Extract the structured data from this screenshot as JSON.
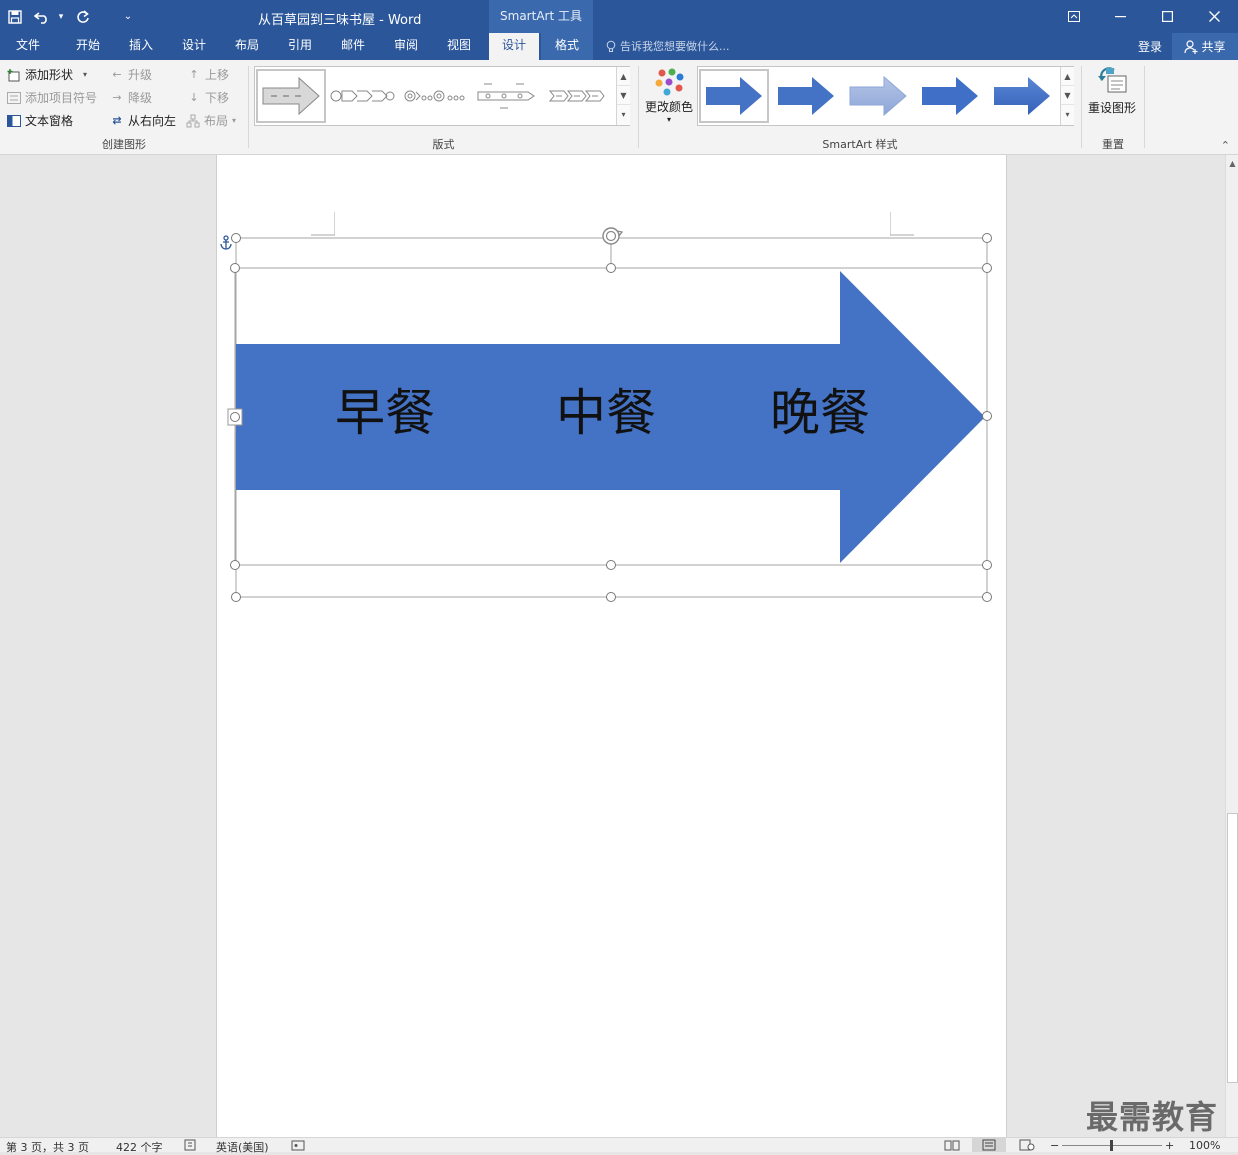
{
  "titlebar": {
    "doc_title": "从百草园到三味书屋 - Word",
    "context_title": "SmartArt 工具",
    "qat_customize": "⌄"
  },
  "tabs": [
    {
      "label": "文件"
    },
    {
      "label": "开始"
    },
    {
      "label": "插入"
    },
    {
      "label": "设计"
    },
    {
      "label": "布局"
    },
    {
      "label": "引用"
    },
    {
      "label": "邮件"
    },
    {
      "label": "审阅"
    },
    {
      "label": "视图"
    },
    {
      "label": "设计"
    },
    {
      "label": "格式"
    }
  ],
  "tellme": {
    "placeholder": "告诉我您想要做什么..."
  },
  "account": {
    "login": "登录",
    "share": "共享"
  },
  "ribbon": {
    "create": {
      "add_shape": "添加形状",
      "add_bullet": "添加项目符号",
      "text_pane": "文本窗格",
      "promote": "升级",
      "demote": "降级",
      "right_to_left": "从右向左",
      "move_up": "上移",
      "move_down": "下移",
      "layout": "布局",
      "label": "创建图形"
    },
    "layouts": {
      "label": "版式"
    },
    "styles": {
      "change_colors": "更改颜色",
      "label": "SmartArt 样式"
    },
    "reset": {
      "reset_graphic": "重设图形",
      "label": "重置"
    }
  },
  "smartart": {
    "items": [
      "早餐",
      "中餐",
      "晚餐"
    ],
    "arrow_color": "#4472c4"
  },
  "status": {
    "page": "第 3 页，共 3 页",
    "words": "422 个字",
    "language": "英语(美国)",
    "zoom": "100%"
  },
  "watermark": "最需教育"
}
